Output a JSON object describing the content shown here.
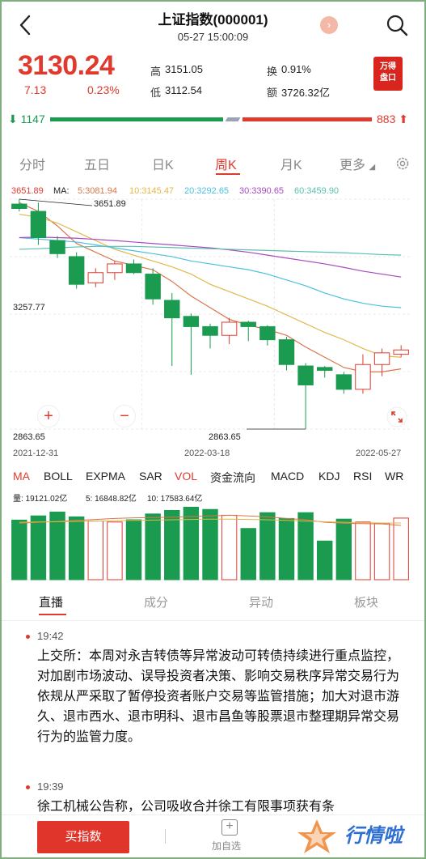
{
  "header": {
    "title": "上证指数(000001)",
    "datetime": "05-27 15:00:09"
  },
  "quote": {
    "price": "3130.24",
    "change": "7.13",
    "change_pct": "0.23%",
    "high_label": "高",
    "high": "3151.05",
    "low_label": "低",
    "low": "3112.54",
    "turnover_label": "换",
    "turnover": "0.91%",
    "amount_label": "额",
    "amount": "3726.32亿",
    "badge": "万得\n盘口"
  },
  "breadth": {
    "up": "1147",
    "down": "883"
  },
  "tabs": [
    "分时",
    "五日",
    "日K",
    "周K",
    "月K",
    "更多"
  ],
  "active_tab": "周K",
  "ma": {
    "price_label": "3651.89",
    "ma_label": "MA:",
    "ma5": "5:3081.94",
    "ma10": "10:3145.47",
    "ma20": "20:3292.65",
    "ma30": "30:3390.65",
    "ma60": "60:3459.90"
  },
  "chart_labels": {
    "high_mark": "3651.89",
    "mid": "3257.77",
    "low": "2863.65",
    "low_mark": "2863.65",
    "date_start": "2021-12-31",
    "date_mid": "2022-03-18",
    "date_end": "2022-05-27",
    "zoom_in": "+",
    "zoom_out": "−"
  },
  "indicators": [
    "MA",
    "BOLL",
    "EXPMA",
    "SAR",
    "VOL",
    "资金流向",
    "MACD",
    "KDJ",
    "RSI",
    "WR"
  ],
  "vol_legend": {
    "vol": "量: 19121.02亿",
    "v5": "5: 16848.82亿",
    "v10": "10: 17583.64亿"
  },
  "sections": [
    "直播",
    "成分",
    "异动",
    "板块"
  ],
  "news": [
    {
      "time": "19:42",
      "text": "上交所：本周对永吉转债等异常波动可转债持续进行重点监控，对加剧市场波动、误导投资者决策、影响交易秩序异常交易行为依规从严采取了暂停投资者账户交易等监管措施；加大对退市游久、退市西水、退市明科、退市昌鱼等股票退市整理期异常交易行为的监管力度。"
    },
    {
      "time": "19:39",
      "text": "徐工机械公告称，公司吸收合并徐工有限事项获有条"
    }
  ],
  "bottom": {
    "buy": "买指数",
    "add": "加自选",
    "watermark": "行情啦"
  },
  "colors": {
    "up": "#e03a2e",
    "down": "#1a9b50"
  },
  "chart_data": {
    "type": "candlestick",
    "period": "weekly",
    "x_range": [
      "2021-12-31",
      "2022-05-27"
    ],
    "ylim": [
      2863.65,
      3651.89
    ],
    "candles": [
      {
        "open": 3635,
        "close": 3620,
        "high": 3651.89,
        "low": 3610
      },
      {
        "open": 3610,
        "close": 3520,
        "high": 3640,
        "low": 3495
      },
      {
        "open": 3510,
        "close": 3465,
        "high": 3525,
        "low": 3450
      },
      {
        "open": 3455,
        "close": 3360,
        "high": 3470,
        "low": 3345
      },
      {
        "open": 3365,
        "close": 3400,
        "high": 3415,
        "low": 3350
      },
      {
        "open": 3400,
        "close": 3430,
        "high": 3440,
        "low": 3375
      },
      {
        "open": 3430,
        "close": 3400,
        "high": 3445,
        "low": 3395
      },
      {
        "open": 3395,
        "close": 3310,
        "high": 3415,
        "low": 3290
      },
      {
        "open": 3305,
        "close": 3245,
        "high": 3330,
        "low": 3080
      },
      {
        "open": 3250,
        "close": 3215,
        "high": 3260,
        "low": 3050
      },
      {
        "open": 3215,
        "close": 3185,
        "high": 3225,
        "low": 3140
      },
      {
        "open": 3185,
        "close": 3230,
        "high": 3245,
        "low": 3155
      },
      {
        "open": 3230,
        "close": 3215,
        "high": 3235,
        "low": 3165
      },
      {
        "open": 3215,
        "close": 3170,
        "high": 3220,
        "low": 3150
      },
      {
        "open": 3170,
        "close": 3085,
        "high": 3180,
        "low": 3065
      },
      {
        "open": 3080,
        "close": 3015,
        "high": 3090,
        "low": 2863.65
      },
      {
        "open": 3075,
        "close": 3065,
        "high": 3080,
        "low": 3040
      },
      {
        "open": 3050,
        "close": 3000,
        "high": 3060,
        "low": 2985
      },
      {
        "open": 3000,
        "close": 3085,
        "high": 3120,
        "low": 2985
      },
      {
        "open": 3085,
        "close": 3125,
        "high": 3140,
        "low": 3045
      },
      {
        "open": 3120,
        "close": 3135,
        "high": 3151,
        "low": 3110
      }
    ],
    "ma_series": [
      {
        "name": "5",
        "color": "#d9764a",
        "values": [
          3640,
          3610,
          3560,
          3500,
          3470,
          3440,
          3425,
          3410,
          3370,
          3320,
          3280,
          3240,
          3220,
          3205,
          3185,
          3145,
          3110,
          3075,
          3060,
          3060,
          3070
        ]
      },
      {
        "name": "10",
        "color": "#e0b84a",
        "values": [
          3600,
          3590,
          3570,
          3540,
          3510,
          3480,
          3460,
          3440,
          3420,
          3395,
          3360,
          3335,
          3310,
          3285,
          3255,
          3225,
          3195,
          3170,
          3140,
          3115,
          3110
        ]
      },
      {
        "name": "20",
        "color": "#4ac0e0",
        "values": [
          3520,
          3515,
          3510,
          3505,
          3495,
          3485,
          3475,
          3465,
          3455,
          3440,
          3430,
          3420,
          3410,
          3395,
          3375,
          3355,
          3330,
          3310,
          3295,
          3285,
          3280
        ]
      },
      {
        "name": "30",
        "color": "#a84ac0",
        "values": [
          3520,
          3522,
          3520,
          3518,
          3514,
          3510,
          3505,
          3500,
          3495,
          3490,
          3485,
          3478,
          3470,
          3460,
          3450,
          3440,
          3430,
          3418,
          3405,
          3395,
          3385
        ]
      },
      {
        "name": "60",
        "color": "#5ac0b0",
        "values": [
          3480,
          3482,
          3485,
          3488,
          3490,
          3490,
          3490,
          3488,
          3486,
          3484,
          3482,
          3480,
          3478,
          3476,
          3474,
          3472,
          3470,
          3468,
          3465,
          3462,
          3460
        ]
      }
    ],
    "volume": {
      "values": [
        18500,
        19800,
        21000,
        19500,
        18200,
        17900,
        18600,
        20400,
        21500,
        22500,
        21800,
        20000,
        15900,
        20800,
        19000,
        20800,
        12000,
        18800,
        17900,
        17500,
        19121.02
      ],
      "ma5": [
        17500,
        17800,
        18100,
        18400,
        18700,
        19000,
        19200,
        19300,
        19400,
        19600,
        19800,
        20000,
        19800,
        19500,
        19000,
        18600,
        17800,
        17500,
        17400,
        17300,
        16848.82
      ],
      "ma10": [
        17800,
        17900,
        18000,
        18100,
        18200,
        18300,
        18400,
        18500,
        18600,
        18700,
        18800,
        18800,
        18700,
        18600,
        18400,
        18200,
        18000,
        17800,
        17700,
        17600,
        17583.64
      ]
    }
  }
}
